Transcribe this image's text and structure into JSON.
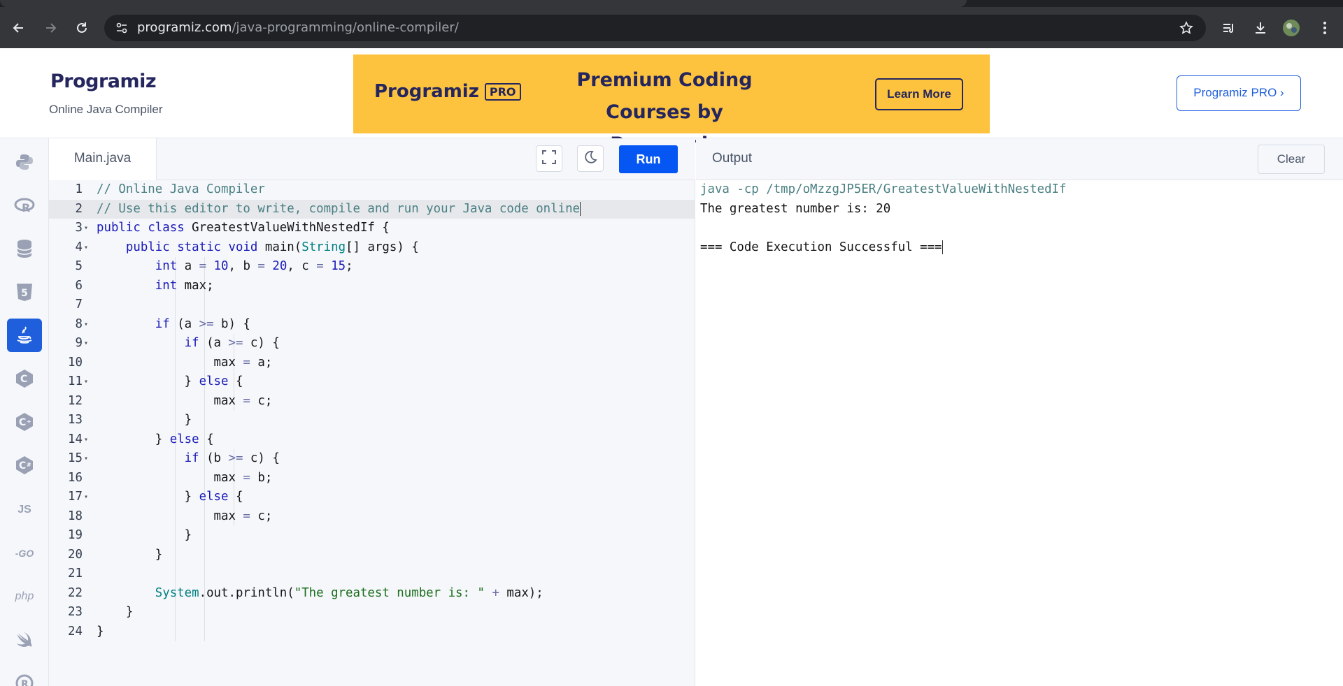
{
  "browser": {
    "url_host": "programiz.com",
    "url_path": "/java-programming/online-compiler/"
  },
  "header": {
    "logo_text": "Programiz",
    "subtitle": "Online Java Compiler",
    "banner": {
      "brand": "Programiz",
      "badge": "PRO",
      "title_line1": "Premium Coding",
      "title_line2": "Courses by Programiz",
      "cta": "Learn More"
    },
    "pro_button": "Programiz PRO ›"
  },
  "sidebar": {
    "items": [
      {
        "name": "python",
        "label": "",
        "active": false
      },
      {
        "name": "r",
        "label": "R",
        "active": false
      },
      {
        "name": "sql",
        "label": "",
        "active": false
      },
      {
        "name": "html",
        "label": "5",
        "active": false
      },
      {
        "name": "java",
        "label": "",
        "active": true
      },
      {
        "name": "c",
        "label": "C",
        "active": false
      },
      {
        "name": "cpp",
        "label": "C",
        "active": false
      },
      {
        "name": "csharp",
        "label": "C",
        "active": false
      },
      {
        "name": "javascript",
        "label": "JS",
        "active": false
      },
      {
        "name": "go",
        "label": "-GO",
        "active": false
      },
      {
        "name": "php",
        "label": "php",
        "active": false
      },
      {
        "name": "swift",
        "label": "",
        "active": false
      },
      {
        "name": "rust",
        "label": "R",
        "active": false
      }
    ]
  },
  "editor": {
    "file_tab": "Main.java",
    "run_label": "Run",
    "active_line": 2
  },
  "output": {
    "title": "Output",
    "clear_label": "Clear",
    "lines": [
      "java -cp /tmp/oMzzgJP5ER/GreatestValueWithNestedIf",
      "The greatest number is: 20",
      "",
      "=== Code Execution Successful ==="
    ]
  }
}
